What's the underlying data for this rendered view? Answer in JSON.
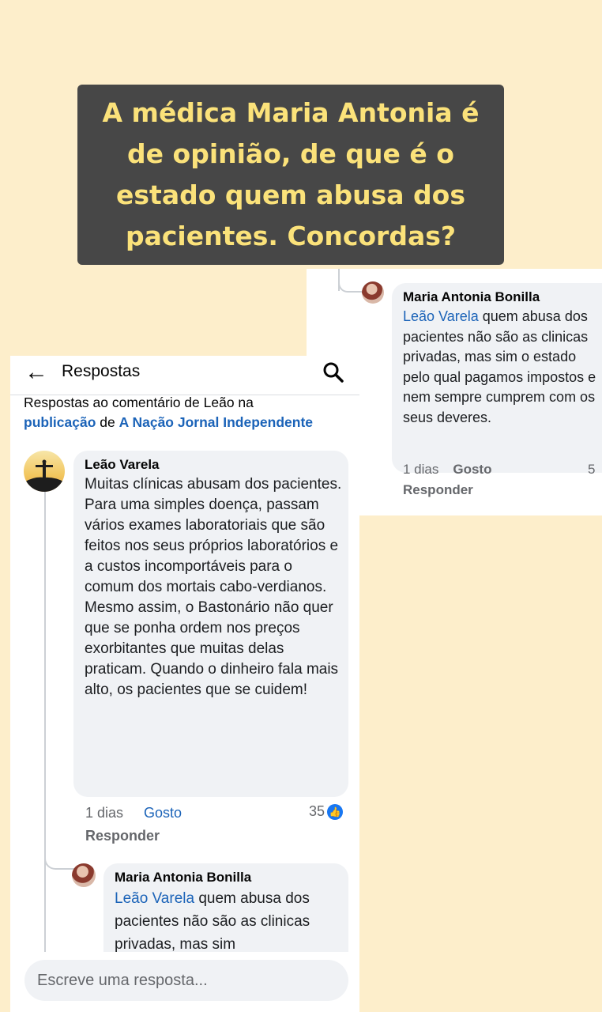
{
  "headline": "A médica Maria Antonia é de opinião, de que é o estado quem abusa dos pacientes. Concordas?",
  "left_screen": {
    "topbar": {
      "title": "Respostas",
      "back_icon": "arrow-left-icon",
      "search_icon": "search-icon"
    },
    "subtitle": {
      "prefix": "Respostas ao comentário de Leão na",
      "link1": "publicação",
      "mid": " de ",
      "link2": "A Nação Jornal Independente"
    },
    "comment": {
      "author": "Leão Varela",
      "text": "Muitas clínicas abusam dos pacientes. Para uma simples doença, passam vários exames laboratoriais que são feitos nos seus próprios laboratórios e a custos incomportáveis para o comum dos mortais cabo-verdianos. Mesmo assim, o Bastonário não quer que se ponha ordem nos preços exorbitantes que muitas delas praticam. Quando o dinheiro fala mais alto, os pacientes que se cuidem!",
      "time": "1 dias",
      "like": "Gosto",
      "reply": "Responder",
      "reactions": "35"
    },
    "reply": {
      "author": "Maria Antonia Bonilla",
      "mention": "Leão Varela",
      "text": " quem abusa dos pacientes não são as clinicas privadas, mas sim"
    },
    "composer": {
      "placeholder": "Escreve uma resposta..."
    }
  },
  "right_screen": {
    "reply": {
      "author": "Maria Antonia Bonilla",
      "mention": "Leão Varela",
      "text": " quem abusa dos pacientes não são as clinicas privadas, mas sim o estado pelo qual pagamos impostos e nem sempre cumprem com os seus deveres.",
      "time": "1 dias",
      "like": "Gosto",
      "reply_label": "Responder",
      "reactions": "5"
    }
  },
  "colors": {
    "background": "#fdeecb",
    "headline_bg": "#474747",
    "headline_text": "#fbe27a",
    "link": "#1b63b8",
    "bubble": "#f0f2f5"
  }
}
